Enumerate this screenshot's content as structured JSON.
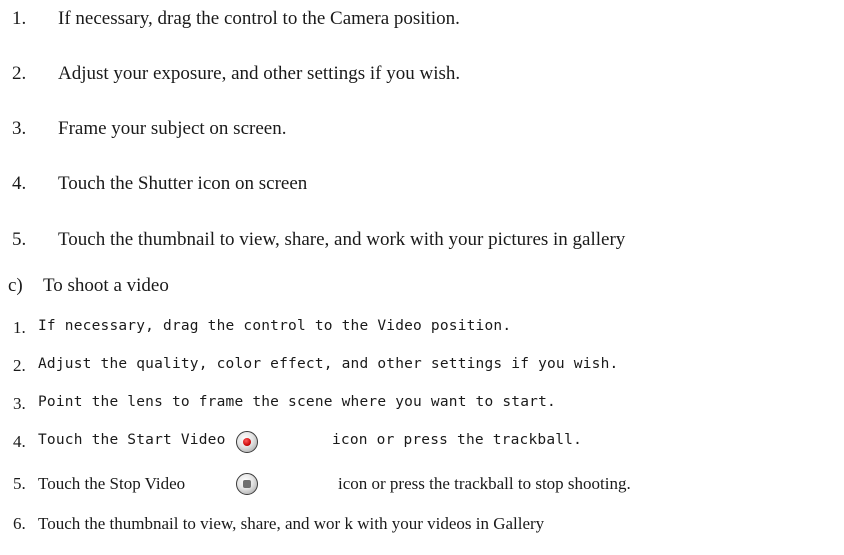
{
  "camera_steps": [
    {
      "num": "1.",
      "text": "If necessary, drag the control to the Camera position."
    },
    {
      "num": "2.",
      "text": "Adjust your exposure, and other settings if you wish."
    },
    {
      "num": "3.",
      "text": "Frame your subject on screen."
    },
    {
      "num": "4.",
      "text": "Touch the Shutter icon on screen"
    },
    {
      "num": "5.",
      "text": "Touch the thumbnail to view, share, and work with your pictures in gallery"
    }
  ],
  "video_section": {
    "marker": "c)",
    "heading": "To shoot a video"
  },
  "video_steps": [
    {
      "num": "1.",
      "text": "If necessary, drag the control to the Video position."
    },
    {
      "num": "2.",
      "text": "Adjust the quality, color effect, and other settings if you wish."
    },
    {
      "num": "3.",
      "text": "Point the lens to frame the scene where you want to start."
    },
    {
      "num": "4.",
      "text_before": "Touch the Start Video",
      "text_after": "icon or press the trackball.",
      "icon": "record-icon"
    },
    {
      "num": "5.",
      "text_before": "Touch the Stop Video",
      "text_after": "icon or press the trackball to stop shooting.",
      "icon": "stop-icon"
    },
    {
      "num": "6.",
      "text": "Touch the thumbnail to view, share, and wor k with your videos in Gallery"
    }
  ]
}
